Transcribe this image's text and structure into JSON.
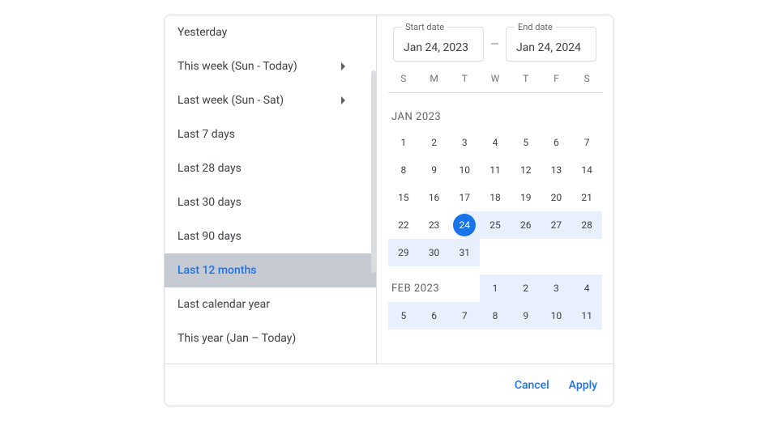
{
  "presets": [
    {
      "label": "Yesterday",
      "hasSubmenu": false
    },
    {
      "label": "This week (Sun - Today)",
      "hasSubmenu": true
    },
    {
      "label": "Last week (Sun - Sat)",
      "hasSubmenu": true
    },
    {
      "label": "Last 7 days",
      "hasSubmenu": false
    },
    {
      "label": "Last 28 days",
      "hasSubmenu": false
    },
    {
      "label": "Last 30 days",
      "hasSubmenu": false
    },
    {
      "label": "Last 90 days",
      "hasSubmenu": false
    },
    {
      "label": "Last 12 months",
      "hasSubmenu": false,
      "selected": true
    },
    {
      "label": "Last calendar year",
      "hasSubmenu": false
    },
    {
      "label": "This year (Jan – Today)",
      "hasSubmenu": false
    }
  ],
  "dateInputs": {
    "startLabel": "Start date",
    "startValue": "Jan 24, 2023",
    "endLabel": "End date",
    "endValue": "Jan 24, 2024",
    "separator": "—"
  },
  "weekdays": [
    "S",
    "M",
    "T",
    "W",
    "T",
    "F",
    "S"
  ],
  "months": [
    {
      "label": "JAN 2023",
      "leadingEmpty": 0,
      "days": 31,
      "rangeStartDay": 24,
      "startSelectedDay": 24
    },
    {
      "label": "FEB 2023",
      "leadingEmpty": 3,
      "days": 11,
      "allInRange": true,
      "labelInFirstRow": true
    }
  ],
  "footer": {
    "cancel": "Cancel",
    "apply": "Apply"
  }
}
